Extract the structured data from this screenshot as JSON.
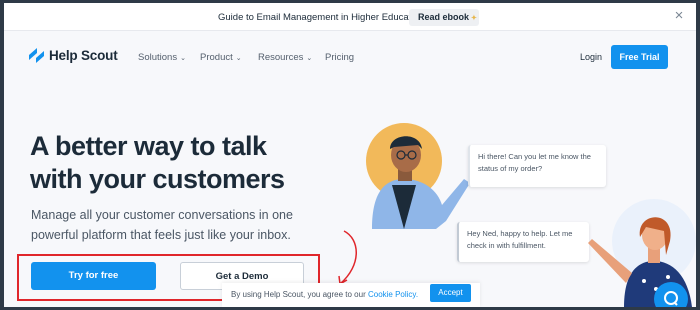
{
  "announcement": {
    "text": "Guide to Email Management in Higher Education",
    "button_label": "Read ebook",
    "button_icon": "sparkle-icon",
    "close_icon": "close-icon"
  },
  "nav": {
    "logo_text": "Help Scout",
    "items": [
      {
        "label": "Solutions",
        "has_dropdown": true
      },
      {
        "label": "Product",
        "has_dropdown": true
      },
      {
        "label": "Resources",
        "has_dropdown": true
      },
      {
        "label": "Pricing",
        "has_dropdown": false
      }
    ],
    "login_label": "Login",
    "trial_label": "Free Trial"
  },
  "hero": {
    "headline": "A better way to talk with your customers",
    "subhead": "Manage all your customer conversations in one powerful platform that feels just like your inbox.",
    "primary_cta": "Try for free",
    "secondary_cta": "Get a Demo"
  },
  "illustration": {
    "bubble_1": "Hi there! Can you let me know the status of my order?",
    "bubble_2": "Hey Ned, happy to help. Let me check in with fulfillment."
  },
  "cookie": {
    "text_before": "By using Help Scout, you agree to our ",
    "link_text": "Cookie Policy.",
    "accept_label": "Accept"
  },
  "colors": {
    "brand_blue": "#1292ee",
    "ink": "#1c2b39",
    "highlight_red": "#e0262b",
    "accent_orange": "#f2b95a"
  }
}
